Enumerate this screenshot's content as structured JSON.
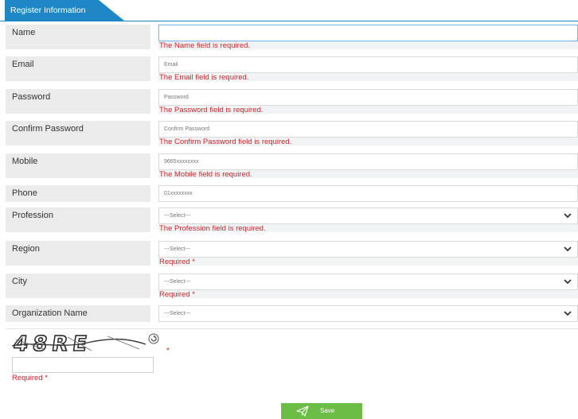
{
  "header": {
    "tab_label": "Register Information"
  },
  "fields": [
    {
      "label": "Name",
      "value": "",
      "error": "The Name field is required."
    },
    {
      "label": "Email",
      "placeholder": "Email",
      "error": "The Email field is required."
    },
    {
      "label": "Password",
      "placeholder": "Password",
      "error": "The Password field is required."
    },
    {
      "label": "Confirm Password",
      "placeholder": "Confirm Password",
      "error": "The Confirm Password field is required."
    },
    {
      "label": "Mobile",
      "placeholder": "9665xxxxxxxx",
      "error": "The Mobile field is required."
    },
    {
      "label": "Phone",
      "placeholder": "01xxxxxxxx"
    },
    {
      "label": "Profession",
      "selected": "---Select---",
      "error": "The Profession field is required."
    },
    {
      "label": "Region",
      "selected": "---Select---",
      "error": "Required *"
    },
    {
      "label": "City",
      "selected": "---Select---",
      "error": "Required *"
    },
    {
      "label": "Organization Name",
      "selected": "---Select---"
    }
  ],
  "captcha": {
    "image_text": "48RE",
    "required_mark": "*",
    "error": "Required *",
    "refresh_icon": "refresh-icon"
  },
  "actions": {
    "save_label": "Save",
    "save_icon": "paper-plane-icon",
    "save_color": "#6cbd45"
  },
  "colors": {
    "tab": "#1e88c7",
    "error": "#d0232b"
  }
}
